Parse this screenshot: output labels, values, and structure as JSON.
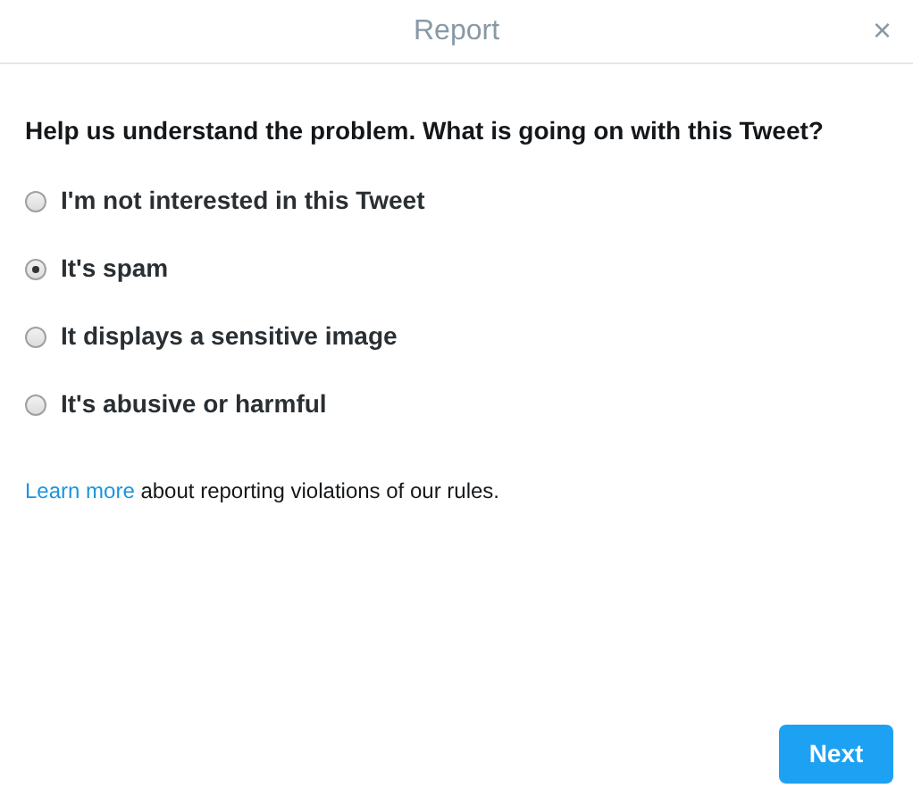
{
  "dialog": {
    "title": "Report",
    "close": "×"
  },
  "question": "Help us understand the problem. What is going on with this Tweet?",
  "options": [
    {
      "label": "I'm not interested in this Tweet",
      "selected": false
    },
    {
      "label": "It's spam",
      "selected": true
    },
    {
      "label": "It displays a sensitive image",
      "selected": false
    },
    {
      "label": "It's abusive or harmful",
      "selected": false
    }
  ],
  "note": {
    "link": "Learn more",
    "text": "about reporting violations of our rules."
  },
  "buttons": [
    "Next"
  ]
}
